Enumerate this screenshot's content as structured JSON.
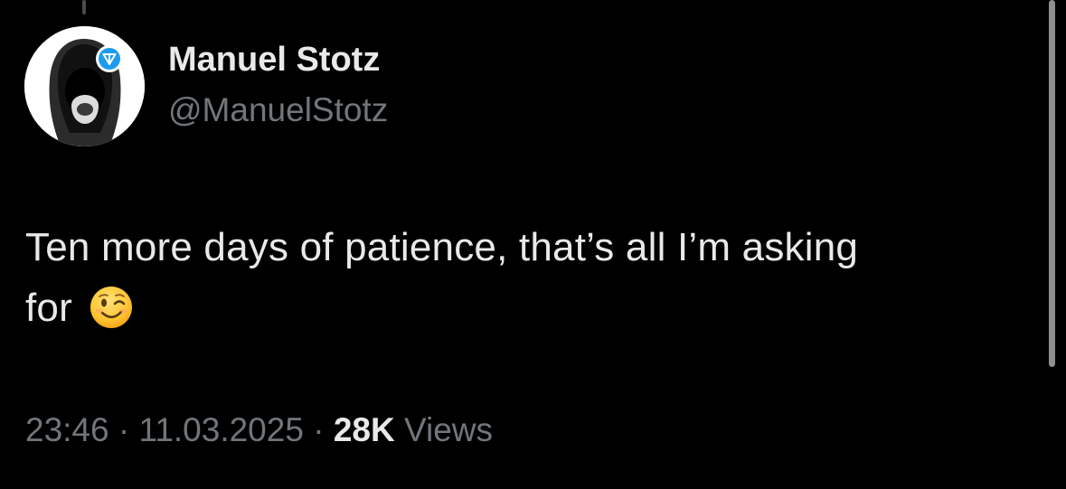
{
  "author": {
    "display_name": "Manuel Stotz",
    "handle": "@ManuelStotz",
    "verified_badge_icon": "ton-diamond-badge-icon",
    "badge_color": "#1d9bf0"
  },
  "tweet": {
    "text_line1": "Ten more days of patience, that’s all I’m asking",
    "text_line2": "for",
    "emoji": "winking-face-emoji"
  },
  "meta": {
    "time": "23:46",
    "separator": "·",
    "date": "11.03.2025",
    "views_count": "28K",
    "views_label": "Views"
  },
  "colors": {
    "background": "#000000",
    "primary_text": "#e7e9ea",
    "secondary_text": "#71767b"
  }
}
